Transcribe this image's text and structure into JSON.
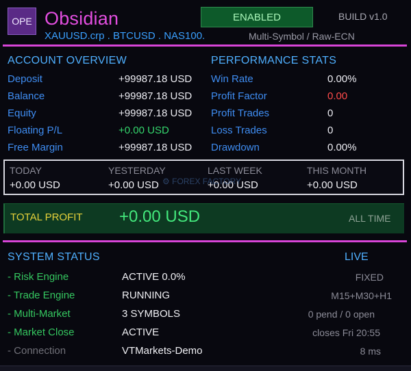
{
  "header": {
    "logo_text": "OPE",
    "title": "Obsidian",
    "symbols": "XAUUSD.crp . BTCUSD . NAS100.",
    "enabled_label": "ENABLED",
    "build": "BUILD v1.0",
    "mode": "Multi-Symbol / Raw-ECN"
  },
  "account": {
    "heading": "ACCOUNT OVERVIEW",
    "rows": [
      {
        "label": "Deposit",
        "value": "+99987.18 USD"
      },
      {
        "label": "Balance",
        "value": "+99987.18 USD"
      },
      {
        "label": "Equity",
        "value": "+99987.18 USD"
      },
      {
        "label": "Floating P/L",
        "value": "+0.00 USD"
      },
      {
        "label": "Free Margin",
        "value": "+99987.18 USD"
      }
    ]
  },
  "performance": {
    "heading": "PERFORMANCE STATS",
    "rows": [
      {
        "label": "Win Rate",
        "value": "0.00%"
      },
      {
        "label": "Profit Factor",
        "value": "0.00"
      },
      {
        "label": "Profit Trades",
        "value": "0"
      },
      {
        "label": "Loss Trades",
        "value": "0"
      },
      {
        "label": "Drawdown",
        "value": "0.00%"
      }
    ]
  },
  "periods": [
    {
      "label": "TODAY",
      "value": "+0.00 USD"
    },
    {
      "label": "YESTERDAY",
      "value": "+0.00 USD"
    },
    {
      "label": "LAST WEEK",
      "value": "+0.00 USD"
    },
    {
      "label": "THIS MONTH",
      "value": "+0.00 USD"
    }
  ],
  "watermark": "FOREX FACTORY",
  "total_profit": {
    "label": "TOTAL PROFIT",
    "value": "+0.00 USD",
    "range": "ALL TIME"
  },
  "system": {
    "heading": "SYSTEM STATUS",
    "live": "LIVE",
    "rows": [
      {
        "label": "- Risk Engine",
        "value": "ACTIVE  0.0%",
        "right": "FIXED"
      },
      {
        "label": "- Trade Engine",
        "value": "RUNNING",
        "right": "M15+M30+H1"
      },
      {
        "label": "- Multi-Market",
        "value": "3 SYMBOLS",
        "right": "0 pend / 0 open"
      },
      {
        "label": "- Market Close",
        "value": "ACTIVE",
        "right": "closes Fri 20:55"
      },
      {
        "label": "- Connection",
        "value": "VTMarkets-Demo",
        "right": "8 ms"
      }
    ]
  },
  "colors": {
    "accent_magenta": "#d845d8",
    "label_blue": "#3f8df2",
    "status_green": "#35c760",
    "profit_gold": "#e7d23a",
    "enabled_green": "#0d5a2a",
    "negative_red": "#ff4a4a"
  }
}
